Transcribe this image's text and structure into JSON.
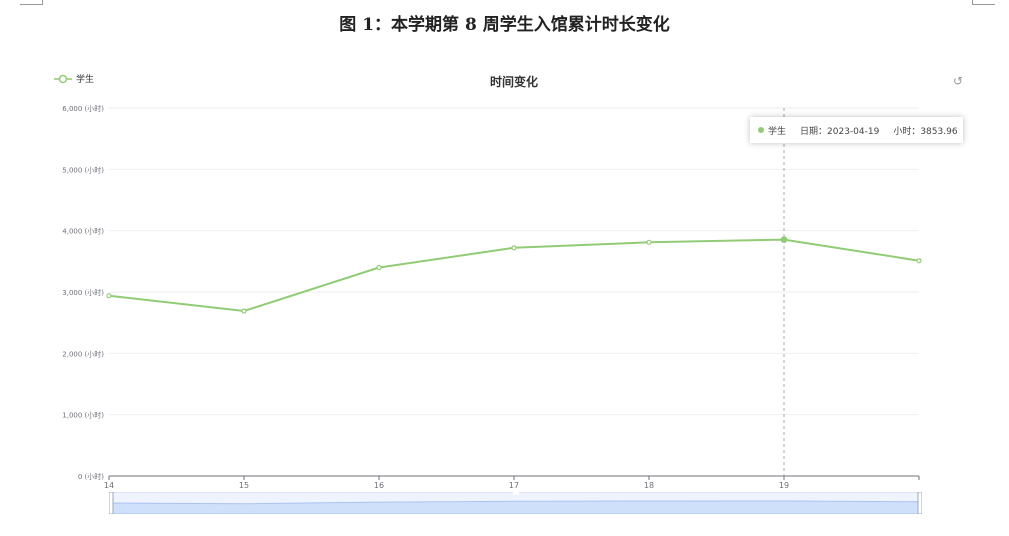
{
  "figure_title": "图 1：本学期第 8 周学生入馆累计时长变化",
  "legend": {
    "series_label": "学生"
  },
  "toolbox": {
    "icon": "restore-icon"
  },
  "tooltip": {
    "series_label": "学生",
    "date_label": "日期：2023-04-19",
    "hours_label": "小时：3853.96"
  },
  "colors": {
    "series": "#91cc75",
    "grid": "#eeeeee",
    "axis": "#6e7079",
    "datazoom_fill": "#cfe0fb"
  },
  "chart_data": {
    "type": "line",
    "title": "时间变化",
    "xlabel": "",
    "ylabel": "",
    "categories": [
      "14",
      "15",
      "16",
      "17",
      "18",
      "19",
      ""
    ],
    "x": [
      14,
      15,
      16,
      17,
      18,
      19,
      20
    ],
    "y_tick_labels": [
      "0 (小时)",
      "1,000 (小时)",
      "2,000 (小时)",
      "3,000 (小时)",
      "4,000 (小时)",
      "5,000 (小时)",
      "6,000 (小时)"
    ],
    "y_ticks": [
      0,
      1000,
      2000,
      3000,
      4000,
      5000,
      6000
    ],
    "ylim": [
      0,
      6000
    ],
    "xlim": [
      14,
      20
    ],
    "series": [
      {
        "name": "学生",
        "values": [
          2940,
          2690,
          3400,
          3720,
          3810,
          3853.96,
          3510
        ]
      }
    ],
    "highlight_x": 19,
    "grid": true,
    "legend_position": "top-left"
  }
}
